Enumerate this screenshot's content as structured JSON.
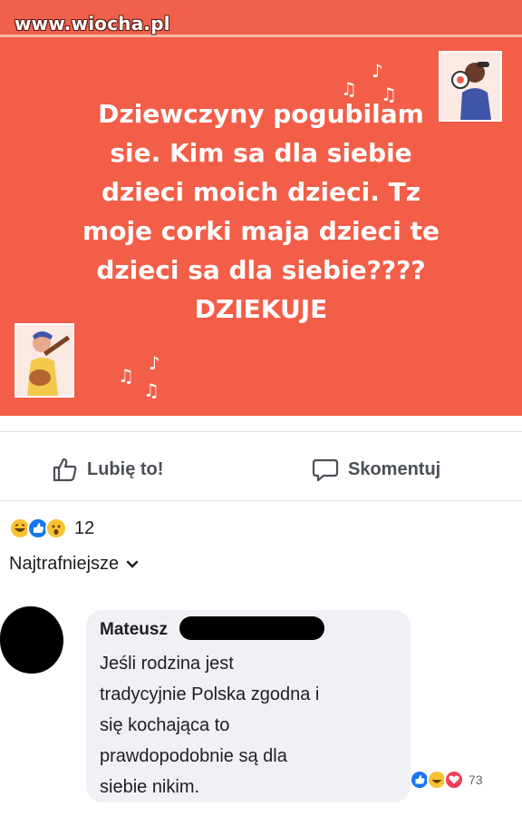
{
  "watermark": "www.wiocha.pl",
  "post": {
    "lines": [
      "Dziewczyny pogubilam",
      "sie. Kim sa dla siebie",
      "dzieci moich dzieci. Tz",
      "moje corki maja dzieci te",
      "dzieci sa dla siebie????",
      "DZIEKUJE"
    ],
    "background_color": "#f25e48"
  },
  "actions": {
    "like_label": "Lubię to!",
    "comment_label": "Skomentuj",
    "like_icon": "thumbs-up-icon",
    "comment_icon": "speech-bubble-icon"
  },
  "reactions": {
    "icons": [
      "laugh-emoji-icon",
      "like-emoji-icon",
      "wow-emoji-icon"
    ],
    "count": "12"
  },
  "sort": {
    "label": "Najtrafniejsze",
    "icon": "chevron-down-icon"
  },
  "comment": {
    "author": "Mateusz",
    "lines": [
      "Jeśli rodzina jest",
      "tradycyjnie Polska zgodna i",
      "się kochająca to",
      "prawdopodobnie są dla",
      "siebie nikim."
    ],
    "reaction_icons": [
      "like-emoji-icon",
      "laugh-emoji-icon",
      "love-emoji-icon"
    ],
    "reaction_count": "73"
  }
}
